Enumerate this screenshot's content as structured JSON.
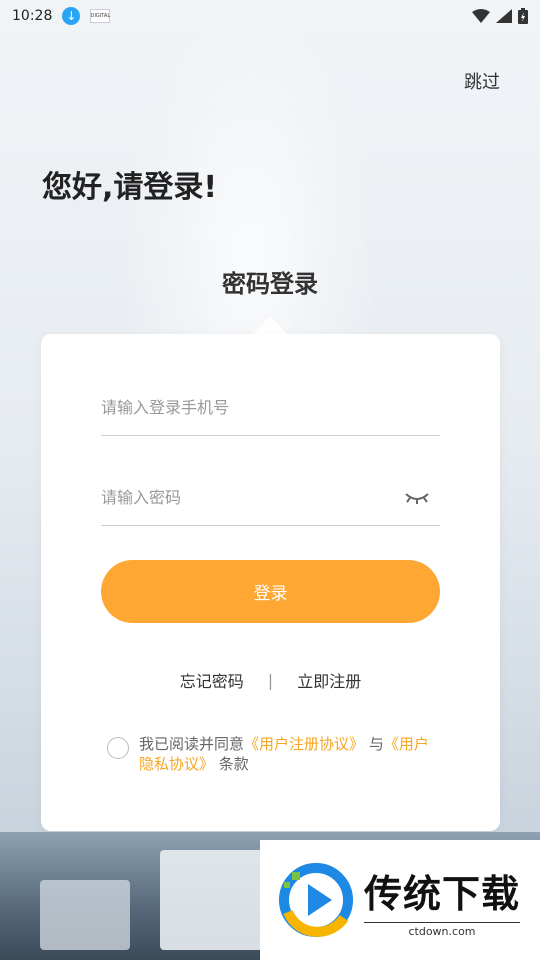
{
  "status_bar": {
    "time": "10:28",
    "mini_app": "DIGITAL"
  },
  "header": {
    "skip_label": "跳过",
    "greeting": "您好,请登录!"
  },
  "login": {
    "tab_title": "密码登录",
    "phone_placeholder": "请输入登录手机号",
    "password_placeholder": "请输入密码",
    "submit_label": "登录",
    "forgot_label": "忘记密码",
    "separator": "|",
    "register_label": "立即注册"
  },
  "agreement": {
    "prefix": "我已阅读并同意",
    "user_agreement": "《用户注册协议》",
    "conjunction": "与",
    "privacy_policy": "《用户隐私协议》",
    "suffix": "条款"
  },
  "watermark": {
    "title": "传统下载",
    "url": "ctdown.com"
  },
  "colors": {
    "accent": "#ffa733",
    "link": "#f5a623",
    "text": "#222222"
  }
}
